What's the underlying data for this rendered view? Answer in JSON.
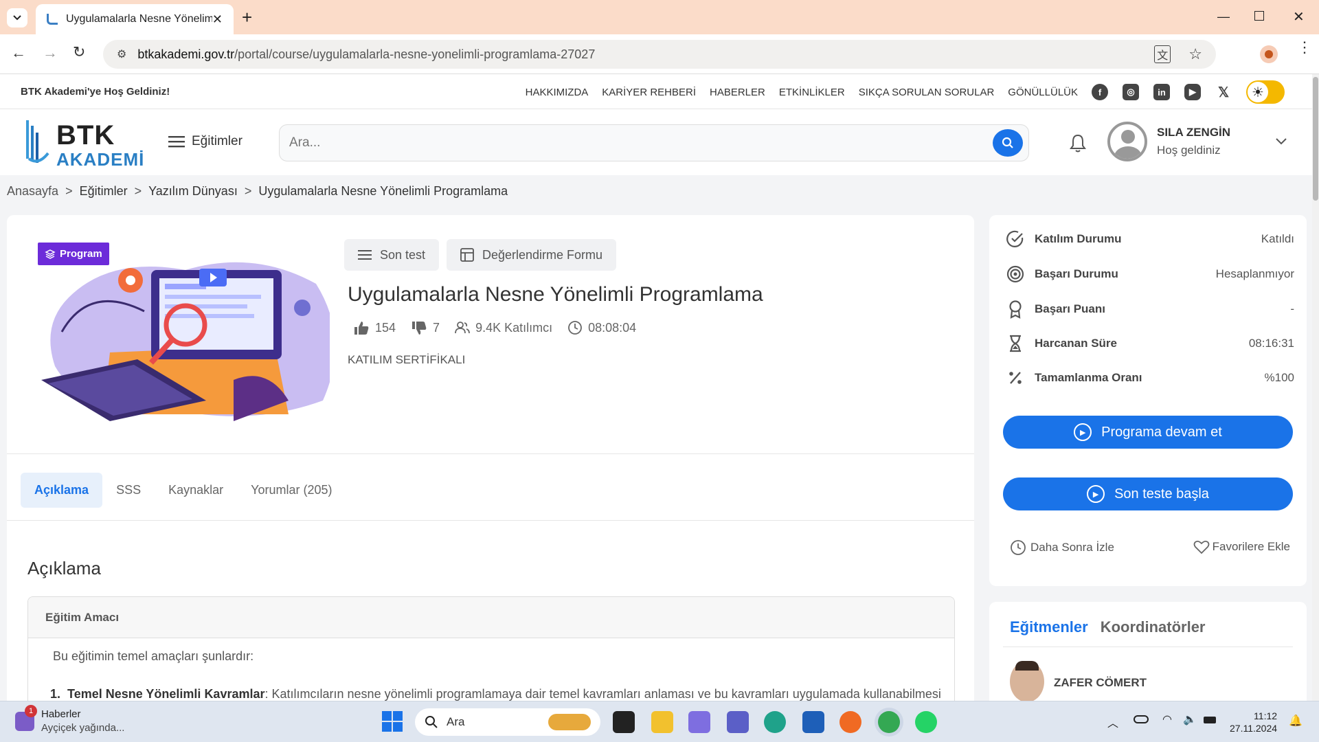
{
  "browser": {
    "tab_title": "Uygulamalarla Nesne Yönelimli",
    "url_host": "btkakademi.gov.tr",
    "url_path": "/portal/course/uygulamalarla-nesne-yonelimli-programlama-27027"
  },
  "site": {
    "welcome": "BTK Akademi'ye Hoş Geldiniz!",
    "topnav": [
      "HAKKIMIZDA",
      "KARİYER REHBERİ",
      "HABERLER",
      "ETKİNLİKLER",
      "SIKÇA SORULAN SORULAR",
      "GÖNÜLLÜLÜK"
    ],
    "logo_top": "BTK",
    "logo_bottom": "AKADEMİ",
    "menu_label": "Eğitimler",
    "search_placeholder": "Ara...",
    "user_name": "SILA ZENGİN",
    "user_greeting": "Hoş geldiniz"
  },
  "breadcrumb": [
    "Anasayfa",
    "Eğitimler",
    "Yazılım Dünyası",
    "Uygulamalarla Nesne Yönelimli Programlama"
  ],
  "course": {
    "badge": "Program",
    "btn_last_test": "Son test",
    "btn_eval_form": "Değerlendirme Formu",
    "title": "Uygulamalarla Nesne Yönelimli Programlama",
    "likes": "154",
    "dislikes": "7",
    "participants": "9.4K Katılımcı",
    "duration": "08:08:04",
    "certificate": "KATILIM SERTİFİKALI",
    "tabs": [
      "Açıklama",
      "SSS",
      "Kaynaklar",
      "Yorumlar (205)"
    ],
    "section_title": "Açıklama",
    "box_title": "Eğitim Amacı",
    "intro": "Bu eğitimin temel amaçları şunlardır:",
    "item1_num": "1.",
    "item1_bold": "Temel Nesne Yönelimli Kavramlar",
    "item1_text": ": Katılımcıların nesne yönelimli programlamaya dair temel kavramları anlaması ve bu kavramları uygulamada kullanabilmesi"
  },
  "status": {
    "participation_label": "Katılım Durumu",
    "participation_value": "Katıldı",
    "success_label": "Başarı Durumu",
    "success_value": "Hesaplanmıyor",
    "score_label": "Başarı Puanı",
    "score_value": "-",
    "time_label": "Harcanan Süre",
    "time_value": "08:16:31",
    "completion_label": "Tamamlanma Oranı",
    "completion_value": "%100",
    "continue_btn": "Programa devam et",
    "final_test_btn": "Son teste başla",
    "watch_later": "Daha Sonra İzle",
    "add_fav": "Favorilere Ekle"
  },
  "instructors": {
    "tab_a": "Eğitmenler",
    "tab_b": "Koordinatörler",
    "name": "ZAFER CÖMERT"
  },
  "taskbar": {
    "news_title": "Haberler",
    "news_sub": "Ayçiçek yağında...",
    "news_badge": "1",
    "search": "Ara",
    "time": "11:12",
    "date": "27.11.2024"
  },
  "colors": {
    "primary": "#1a73e8",
    "badge": "#6c2bd9",
    "toggle": "#f4b800"
  }
}
